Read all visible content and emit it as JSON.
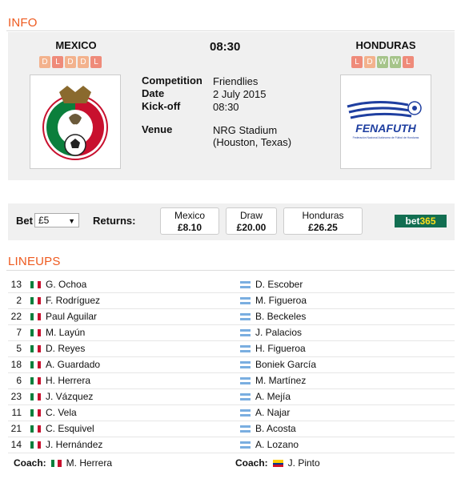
{
  "info": {
    "section_title": "INFO",
    "home": {
      "name": "MEXICO",
      "form": [
        "D",
        "L",
        "D",
        "D",
        "L"
      ]
    },
    "away": {
      "name": "HONDURAS",
      "form": [
        "L",
        "D",
        "W",
        "W",
        "L"
      ]
    },
    "kickoff_time": "08:30",
    "details": [
      {
        "label": "Competition",
        "value": "Friendlies"
      },
      {
        "label": "Date",
        "value": "2 July 2015"
      },
      {
        "label": "Kick-off",
        "value": "08:30"
      },
      {
        "label": "Venue",
        "value": "NRG Stadium (Houston, Texas)"
      }
    ],
    "away_crest_text": "FENAFUTH",
    "away_crest_subtext": "Federación Nacional Autónoma de Fútbol de Honduras"
  },
  "bet": {
    "label": "Bet",
    "stake": "£5",
    "returns_label": "Returns:",
    "odds": [
      {
        "name": "Mexico",
        "price": "£8.10"
      },
      {
        "name": "Draw",
        "price": "£20.00"
      },
      {
        "name": "Honduras",
        "price": "£26.25"
      }
    ],
    "bookmaker": {
      "part1": "bet",
      "part2": "365"
    }
  },
  "lineups": {
    "section_title": "LINEUPS",
    "home": [
      {
        "number": "13",
        "name": "G. Ochoa"
      },
      {
        "number": "2",
        "name": "F. Rodríguez"
      },
      {
        "number": "22",
        "name": "Paul Aguilar"
      },
      {
        "number": "7",
        "name": "M. Layún"
      },
      {
        "number": "5",
        "name": "D. Reyes"
      },
      {
        "number": "18",
        "name": "A. Guardado"
      },
      {
        "number": "6",
        "name": "H. Herrera"
      },
      {
        "number": "23",
        "name": "J. Vázquez"
      },
      {
        "number": "11",
        "name": "C. Vela"
      },
      {
        "number": "21",
        "name": "C. Esquivel"
      },
      {
        "number": "14",
        "name": "J. Hernández"
      }
    ],
    "away": [
      {
        "name": "D. Escober"
      },
      {
        "name": "M. Figueroa"
      },
      {
        "name": "B. Beckeles"
      },
      {
        "name": "J. Palacios"
      },
      {
        "name": "H. Figueroa"
      },
      {
        "name": "Boniek García"
      },
      {
        "name": "M. Martínez"
      },
      {
        "name": "A. Mejía"
      },
      {
        "name": "A. Najar"
      },
      {
        "name": "B. Acosta"
      },
      {
        "name": "A. Lozano"
      }
    ],
    "coach_label": "Coach:",
    "home_coach": "M. Herrera",
    "away_coach": "J. Pinto"
  },
  "colors": {
    "accent": "#ee5a1f",
    "panel": "#f0f0f0",
    "bet365_green": "#126e51"
  }
}
